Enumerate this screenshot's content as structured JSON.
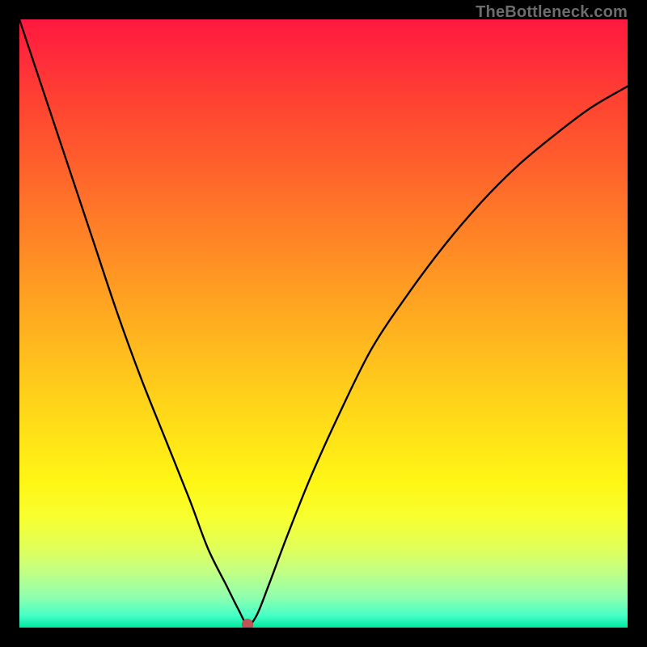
{
  "attribution": "TheBottleneck.com",
  "chart_data": {
    "type": "line",
    "title": "",
    "xlabel": "",
    "ylabel": "",
    "xlim": [
      0,
      100
    ],
    "ylim": [
      0,
      100
    ],
    "background_gradient": {
      "top": "#ff193f",
      "bottom": "#00e8a0",
      "meaning": "red high / green low"
    },
    "series": [
      {
        "name": "bottleneck-curve",
        "x": [
          0,
          4,
          8,
          12,
          16,
          20,
          24,
          28,
          31,
          34,
          36,
          37.5,
          39,
          41,
          44,
          48,
          53,
          58,
          64,
          70,
          76,
          82,
          88,
          94,
          100
        ],
        "values": [
          100,
          88,
          76,
          64,
          52,
          41,
          31,
          21,
          13,
          7,
          3,
          0.5,
          2,
          7,
          15,
          25,
          36,
          46,
          55,
          63,
          70,
          76,
          81,
          85.5,
          89
        ]
      }
    ],
    "marker": {
      "name": "minimum-point",
      "x": 37.5,
      "y": 0.5,
      "color": "#c15353"
    }
  }
}
